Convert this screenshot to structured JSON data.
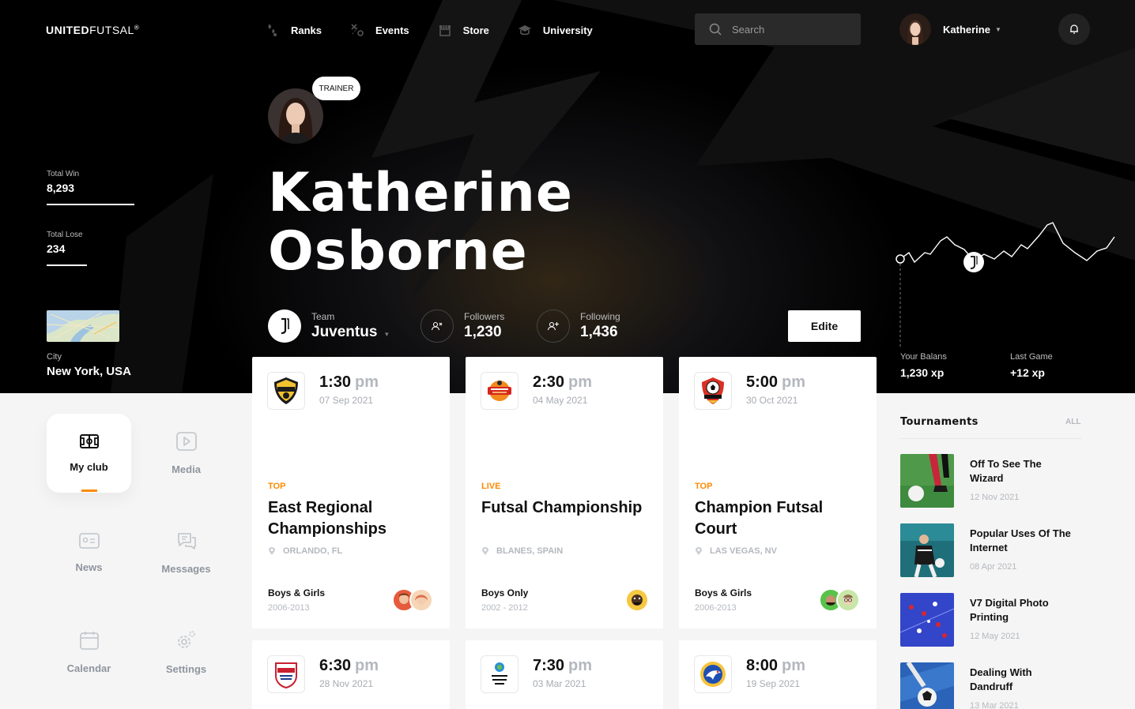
{
  "brand": {
    "bold": "UNITED",
    "light": "FUTSAL",
    "mark": "®"
  },
  "nav": [
    {
      "label": "Ranks",
      "icon": "ranks-icon"
    },
    {
      "label": "Events",
      "icon": "events-icon"
    },
    {
      "label": "Store",
      "icon": "store-icon"
    },
    {
      "label": "University",
      "icon": "university-icon"
    }
  ],
  "search": {
    "placeholder": "Search"
  },
  "user": {
    "name": "Katherine"
  },
  "stats": {
    "total_win_label": "Total Win",
    "total_win": "8,293",
    "total_lose_label": "Total Lose",
    "total_lose": "234"
  },
  "location": {
    "label": "City",
    "value": "New York, USA"
  },
  "profile": {
    "role": "TRAINER",
    "first_name": "Katherine",
    "last_name": "Osborne",
    "team_label": "Team",
    "team": "Juventus",
    "followers_label": "Followers",
    "followers": "1,230",
    "following_label": "Following",
    "following": "1,436",
    "edit_label": "Edite"
  },
  "balance": {
    "label": "Your Balans",
    "value": "1,230 xp",
    "last_label": "Last Game",
    "last_value": "+12 xp"
  },
  "side_menu": [
    {
      "label": "My club",
      "icon": "field-icon",
      "active": true
    },
    {
      "label": "Media",
      "icon": "play-icon"
    },
    {
      "label": "News",
      "icon": "news-icon"
    },
    {
      "label": "Messages",
      "icon": "messages-icon"
    },
    {
      "label": "Calendar",
      "icon": "calendar-icon"
    },
    {
      "label": "Settings",
      "icon": "settings-icon"
    }
  ],
  "events": [
    {
      "time": "1:30",
      "ampm": "pm",
      "date": "07 Sep 2021",
      "tag": "TOP",
      "title": "East Regional Championships",
      "location": "ORLANDO, FL",
      "group": "Boys & Girls",
      "years": "2006-2013"
    },
    {
      "time": "2:30",
      "ampm": "pm",
      "date": "04 May 2021",
      "tag": "LIVE",
      "title": "Futsal Championship",
      "location": "BLANES, SPAIN",
      "group": "Boys Only",
      "years": "2002 - 2012"
    },
    {
      "time": "5:00",
      "ampm": "pm",
      "date": "30 Oct 2021",
      "tag": "TOP",
      "title": "Champion Futsal Court",
      "location": "LAS VEGAS, NV",
      "group": "Boys & Girls",
      "years": "2006-2013"
    },
    {
      "time": "6:30",
      "ampm": "pm",
      "date": "28 Nov 2021"
    },
    {
      "time": "7:30",
      "ampm": "pm",
      "date": "03 Mar 2021"
    },
    {
      "time": "8:00",
      "ampm": "pm",
      "date": "19 Sep 2021"
    }
  ],
  "tournaments": {
    "title": "Tournaments",
    "all_label": "ALL",
    "items": [
      {
        "title": "Off To See The Wizard",
        "date": "12 Nov 2021"
      },
      {
        "title": "Popular Uses Of The Internet",
        "date": "08 Apr 2021"
      },
      {
        "title": "V7 Digital Photo Printing",
        "date": "12 May 2021"
      },
      {
        "title": "Dealing With Dandruff",
        "date": "13 Mar 2021"
      }
    ]
  },
  "colors": {
    "accent": "#ff8a00",
    "dark": "#000000",
    "muted": "#b4b8be"
  }
}
